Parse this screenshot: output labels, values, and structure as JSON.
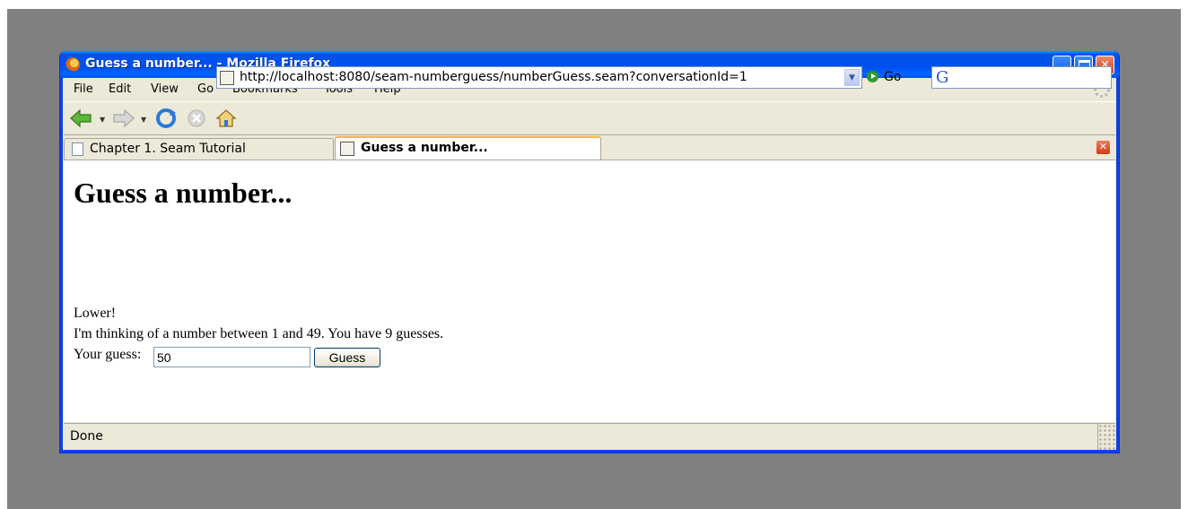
{
  "window": {
    "title": "Guess a number... - Mozilla Firefox"
  },
  "menubar": {
    "items": [
      {
        "label": "File"
      },
      {
        "label": "Edit"
      },
      {
        "label": "View"
      },
      {
        "label": "Go"
      },
      {
        "label": "Bookmarks"
      },
      {
        "label": "Tools"
      },
      {
        "label": "Help"
      }
    ]
  },
  "navbar": {
    "url": "http://localhost:8080/seam-numberguess/numberGuess.seam?conversationId=1",
    "go_label": "Go",
    "search_value": ""
  },
  "tabs": [
    {
      "label": "Chapter 1. Seam Tutorial",
      "active": false
    },
    {
      "label": "Guess a number...",
      "active": true
    }
  ],
  "page": {
    "heading": "Guess a number...",
    "feedback": "Lower!",
    "prompt": "I'm thinking of a number between 1 and 49. You have 9 guesses.",
    "guess_label": "Your guess:",
    "guess_value": "50",
    "guess_button": "Guess"
  },
  "status": {
    "text": "Done"
  },
  "colors": {
    "titlebar": "#0053ee",
    "desktop": "#808080",
    "chrome": "#ece9d8",
    "active_tab_accent": "#f5b93c"
  }
}
